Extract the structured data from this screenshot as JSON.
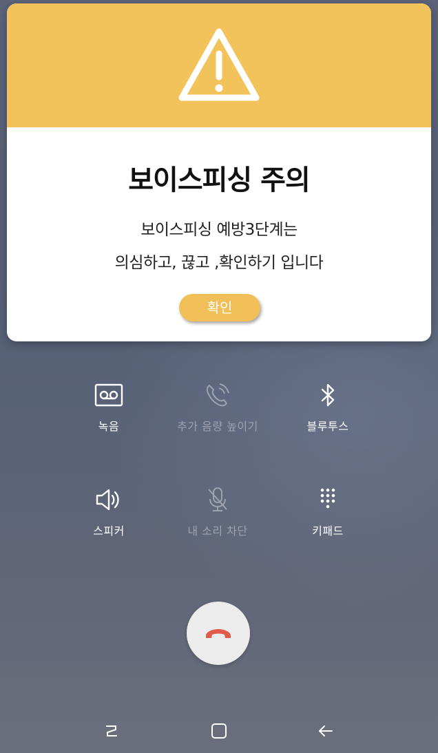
{
  "alert": {
    "icon": "warning-triangle-icon",
    "title": "보이스피싱 주의",
    "message_line1": "보이스피싱 예방3단계는",
    "message_line2": "의심하고, 끊고 ,확인하기 입니다",
    "confirm_label": "확인",
    "header_color": "#f3c35b"
  },
  "controls": [
    {
      "icon": "voicemail-icon",
      "label": "녹음",
      "enabled": true
    },
    {
      "icon": "call-volume-icon",
      "label": "추가 음량 높이기",
      "enabled": false
    },
    {
      "icon": "bluetooth-icon",
      "label": "블루투스",
      "enabled": true
    },
    {
      "icon": "speaker-icon",
      "label": "스피커",
      "enabled": true
    },
    {
      "icon": "mic-mute-icon",
      "label": "내 소리 차단",
      "enabled": false
    },
    {
      "icon": "keypad-icon",
      "label": "키패드",
      "enabled": true
    }
  ],
  "end_call": {
    "icon": "hang-up-icon",
    "color": "#e05b4b"
  },
  "navbar": [
    "recent-apps-icon",
    "home-icon",
    "back-icon"
  ]
}
